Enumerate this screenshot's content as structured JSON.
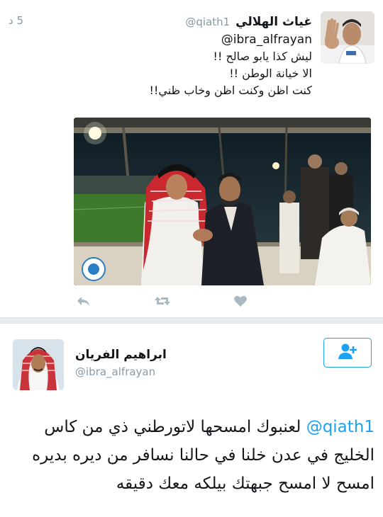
{
  "tweet1": {
    "author_name": "غياث الهلالي",
    "author_handle": "@qiath1",
    "timestamp": "5 د",
    "mention": "@ibra_alfrayan",
    "lines": [
      "ليش كذا يابو صالح !!",
      "الا خيانة الوطن !!",
      "كنت اظن وكنت اظن وخاب ظني!!"
    ],
    "actions": [
      "reply-icon",
      "retweet-icon",
      "like-icon"
    ]
  },
  "tweet2": {
    "author_name": "ابراهيم الفريان",
    "author_handle": "@ibra_alfrayan",
    "mention": "@qiath1",
    "text_first": "لعنبوك امسحها لاتورطني ذي من كاس",
    "text_rest": "الخليج في عدن خلنا في حالنا نسافر من ديره بديره امسح لا امسح جبهتك بيلكه معك دقيقه",
    "follow_icon": "add-user-icon"
  },
  "colors": {
    "accent": "#1da1f2",
    "muted": "#8899a6",
    "icon": "#aab8c2",
    "divider": "#e6ecf0"
  }
}
